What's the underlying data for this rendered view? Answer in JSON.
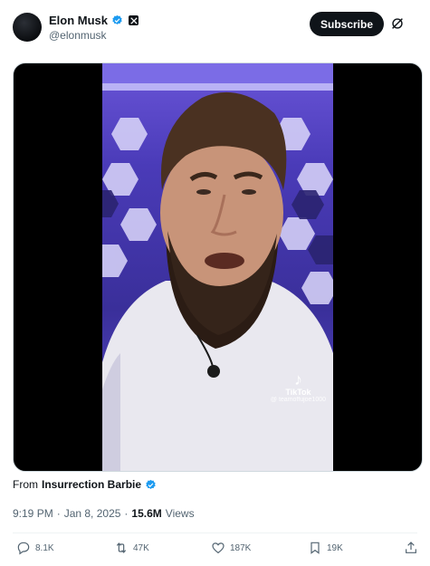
{
  "author": {
    "display_name": "Elon Musk",
    "handle": "@elonmusk",
    "verified": true
  },
  "header": {
    "subscribe_label": "Subscribe"
  },
  "media": {
    "watermark_brand": "TikTok",
    "watermark_user": "@ teamoffujoe1000"
  },
  "source": {
    "prefix": "From",
    "name": "Insurrection Barbie",
    "verified": true
  },
  "meta": {
    "time": "9:19 PM",
    "separator": "·",
    "date": "Jan 8, 2025",
    "views_count": "15.6M",
    "views_label": "Views"
  },
  "actions": {
    "replies": "8.1K",
    "reposts": "47K",
    "likes": "187K",
    "bookmarks": "19K"
  },
  "colors": {
    "accent_blue": "#1d9bf0",
    "text_primary": "#0f1419",
    "text_secondary": "#536471"
  },
  "icons": [
    "verified-badge-icon",
    "x-logo-icon",
    "grok-icon",
    "reply-icon",
    "repost-icon",
    "like-icon",
    "bookmark-icon",
    "share-icon",
    "tiktok-logo-icon"
  ]
}
